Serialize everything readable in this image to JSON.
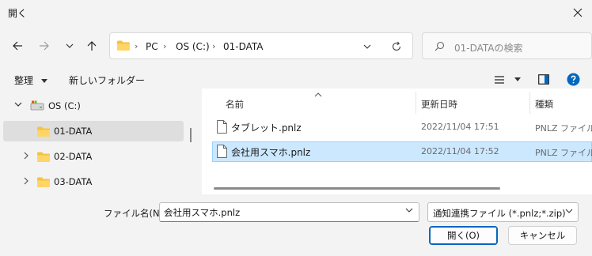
{
  "window": {
    "title": "開く"
  },
  "address": {
    "crumbs": [
      "PC",
      "OS (C:)",
      "01-DATA"
    ]
  },
  "search": {
    "placeholder": "01-DATAの検索"
  },
  "commands": {
    "organize": "整理",
    "new_folder": "新しいフォルダー"
  },
  "tree": {
    "items": [
      {
        "label": "OS (C:)",
        "icon": "drive-icon",
        "expanded": true,
        "selected": false
      },
      {
        "label": "01-DATA",
        "icon": "folder-icon",
        "expanded": false,
        "selected": true
      },
      {
        "label": "02-DATA",
        "icon": "folder-icon",
        "expanded": false,
        "selected": false
      },
      {
        "label": "03-DATA",
        "icon": "folder-icon",
        "expanded": false,
        "selected": false
      }
    ]
  },
  "list": {
    "columns": {
      "name": "名前",
      "date": "更新日時",
      "type": "種類"
    },
    "rows": [
      {
        "name": "タブレット.pnlz",
        "date": "2022/11/04 17:51",
        "type": "PNLZ ファイル",
        "selected": false
      },
      {
        "name": "会社用スマホ.pnlz",
        "date": "2022/11/04 17:52",
        "type": "PNLZ ファイル",
        "selected": true
      }
    ]
  },
  "bottom": {
    "filename_label": "ファイル名(N):",
    "filename_value": "会社用スマホ.pnlz",
    "filetype": "通知連携ファイル (*.pnlz;*.zip)",
    "open_label": "開く(O)",
    "cancel_label": "キャンセル"
  },
  "colors": {
    "accent": "#0067c0",
    "selection": "#cce8ff",
    "folder": "#f5c242",
    "help": "#0067c0"
  }
}
